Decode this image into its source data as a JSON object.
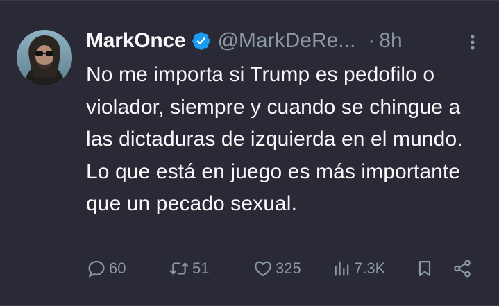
{
  "tweet": {
    "display_name": "MarkOnce",
    "handle": "@MarkDeRe...",
    "separator": "·",
    "time": "8h",
    "verified_icon": "verified-badge-icon",
    "text": "No me importa si Trump es pedofilo o violador, siempre y cuando se chingue a las dictaduras de izquierda en el mundo. Lo que está en juego es más importante que un pecado sexual."
  },
  "actions": {
    "reply_count": "60",
    "retweet_count": "51",
    "like_count": "325",
    "views_count": "7.3K"
  },
  "colors": {
    "background": "#2a2a36",
    "text": "#f7f9f9",
    "muted": "#8b98a5",
    "verified": "#1d9bf0"
  }
}
